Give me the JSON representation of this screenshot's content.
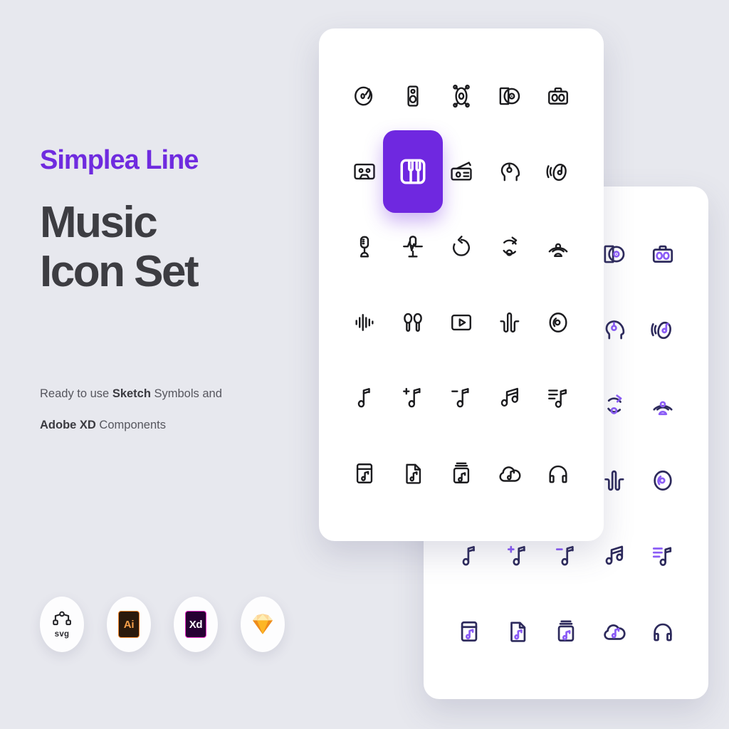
{
  "meta": {
    "background_color": "#e7e8ee",
    "accent_purple": "#6f2bdf",
    "tile_purple": "#6f28e0",
    "icon_dark": "#1c1c1f",
    "back_icon_outline": "#2d2a5c",
    "back_icon_accent": "#8b5cf6"
  },
  "hero": {
    "eyebrow": "Simplea Line",
    "headline": "Music Icon Set",
    "subtitle_line1_prefix": "Ready to use ",
    "subtitle_line1_bold": "Sketch",
    "subtitle_line1_suffix": " Symbols and",
    "subtitle_line2_bold": "Adobe XD",
    "subtitle_line2_suffix": " Components"
  },
  "format_badges": [
    {
      "name": "svg-badge",
      "label": "svg",
      "kind": "svg-path"
    },
    {
      "name": "illustrator-badge",
      "label": "Ai",
      "kind": "adobe-ai"
    },
    {
      "name": "adobe-xd-badge",
      "label": "Xd",
      "kind": "adobe-xd"
    },
    {
      "name": "sketch-badge",
      "label": "",
      "kind": "sketch-gem"
    }
  ],
  "front_card": {
    "highlighted_index": 6,
    "icons": [
      {
        "name": "vinyl-record-icon",
        "glyph": "vinyl"
      },
      {
        "name": "speaker-icon",
        "glyph": "speaker"
      },
      {
        "name": "bass-drum-icon",
        "glyph": "drum"
      },
      {
        "name": "cd-sleeve-icon",
        "glyph": "cd-sleeve"
      },
      {
        "name": "boombox-icon",
        "glyph": "boombox"
      },
      {
        "name": "cassette-tape-icon",
        "glyph": "cassette"
      },
      {
        "name": "piano-keys-icon",
        "glyph": "piano"
      },
      {
        "name": "radio-icon",
        "glyph": "radio"
      },
      {
        "name": "listening-head-icon",
        "glyph": "head"
      },
      {
        "name": "ear-sound-icon",
        "glyph": "ear"
      },
      {
        "name": "microphone-icon",
        "glyph": "mic"
      },
      {
        "name": "mic-waveform-icon",
        "glyph": "mic-wave"
      },
      {
        "name": "repeat-icon",
        "glyph": "repeat"
      },
      {
        "name": "shuffle-repeat-icon",
        "glyph": "repeat-alt"
      },
      {
        "name": "broadcast-podcast-icon",
        "glyph": "broadcast"
      },
      {
        "name": "audio-bars-icon",
        "glyph": "bars"
      },
      {
        "name": "earbuds-icon",
        "glyph": "earbuds"
      },
      {
        "name": "video-play-icon",
        "glyph": "play-box"
      },
      {
        "name": "soundwave-icon",
        "glyph": "wave"
      },
      {
        "name": "disc-icon",
        "glyph": "disc"
      },
      {
        "name": "music-note-icon",
        "glyph": "note"
      },
      {
        "name": "add-note-icon",
        "glyph": "note-plus"
      },
      {
        "name": "remove-note-icon",
        "glyph": "note-minus"
      },
      {
        "name": "double-note-icon",
        "glyph": "note-double"
      },
      {
        "name": "playlist-icon",
        "glyph": "playlist"
      },
      {
        "name": "album-icon",
        "glyph": "album"
      },
      {
        "name": "music-file-icon",
        "glyph": "file-note"
      },
      {
        "name": "album-stack-icon",
        "glyph": "album-stack"
      },
      {
        "name": "cloud-music-icon",
        "glyph": "cloud-note"
      },
      {
        "name": "headphones-icon",
        "glyph": "headphones"
      }
    ]
  },
  "back_card": {
    "style": "two-tone",
    "icons": [
      {
        "name": "cd-sleeve-icon-duotone",
        "glyph": "cd-sleeve"
      },
      {
        "name": "boombox-icon-duotone",
        "glyph": "boombox"
      },
      {
        "name": "listening-head-icon-duotone",
        "glyph": "head"
      },
      {
        "name": "ear-sound-icon-duotone",
        "glyph": "ear"
      },
      {
        "name": "shuffle-repeat-icon-duotone",
        "glyph": "repeat-alt"
      },
      {
        "name": "broadcast-podcast-icon-duotone",
        "glyph": "broadcast"
      },
      {
        "name": "soundwave-icon-duotone",
        "glyph": "wave"
      },
      {
        "name": "disc-icon-duotone",
        "glyph": "disc"
      },
      {
        "name": "music-note-icon-duotone",
        "glyph": "note"
      },
      {
        "name": "add-note-icon-duotone",
        "glyph": "note-plus"
      },
      {
        "name": "remove-note-icon-duotone",
        "glyph": "note-minus"
      },
      {
        "name": "double-note-icon-duotone",
        "glyph": "note-double"
      },
      {
        "name": "playlist-icon-duotone",
        "glyph": "playlist"
      },
      {
        "name": "album-icon-duotone",
        "glyph": "album"
      },
      {
        "name": "music-file-icon-duotone",
        "glyph": "file-note"
      },
      {
        "name": "album-stack-icon-duotone",
        "glyph": "album-stack"
      },
      {
        "name": "cloud-music-icon-duotone",
        "glyph": "cloud-note"
      },
      {
        "name": "headphones-icon-duotone",
        "glyph": "headphones"
      }
    ]
  }
}
